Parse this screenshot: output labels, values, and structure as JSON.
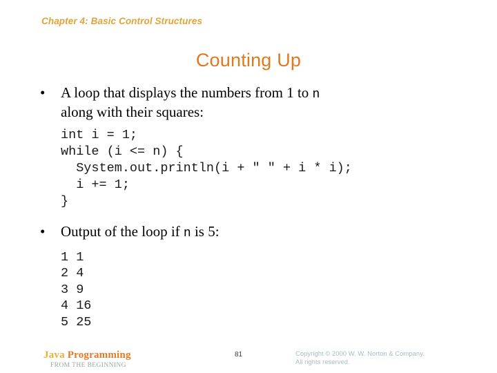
{
  "slide": {
    "chapter_header": "Chapter 4: Basic Control Structures",
    "title": "Counting Up",
    "bullet_mark": "•",
    "bullets": [
      {
        "line1_a": "A loop that displays the numbers from 1 to ",
        "line1_mono": "n",
        "line2": "along with their squares:"
      },
      {
        "line1_a": "Output of the loop if ",
        "line1_mono": "n",
        "line1_b": " is 5:"
      }
    ],
    "code": "int i = 1;\nwhile (i <= n) {\n  System.out.println(i + \" \" + i * i);\n  i += 1;\n}",
    "output": "1 1\n2 4\n3 9\n4 16\n5 25",
    "output_rows": [
      {
        "n": "1",
        "square": "1"
      },
      {
        "n": "2",
        "square": "4"
      },
      {
        "n": "3",
        "square": "9"
      },
      {
        "n": "4",
        "square": "16"
      },
      {
        "n": "5",
        "square": "25"
      }
    ]
  },
  "footer": {
    "brand_part1": "Java ",
    "brand_part2": "Programming",
    "brand_subtitle": "FROM THE BEGINNING",
    "page_number": "81",
    "copyright_line1": "Copyright © 2000 W. W. Norton & Company.",
    "copyright_line2": "All rights reserved."
  },
  "colors": {
    "chapter_header": "#e0a438",
    "title": "#e0781f",
    "brand_gold": "#e8b034",
    "brand_orange": "#e07a22",
    "brand_subtitle": "#91a79b",
    "copyright": "#a9bcc4",
    "body_text": "#000000",
    "background": "#ffffff"
  }
}
